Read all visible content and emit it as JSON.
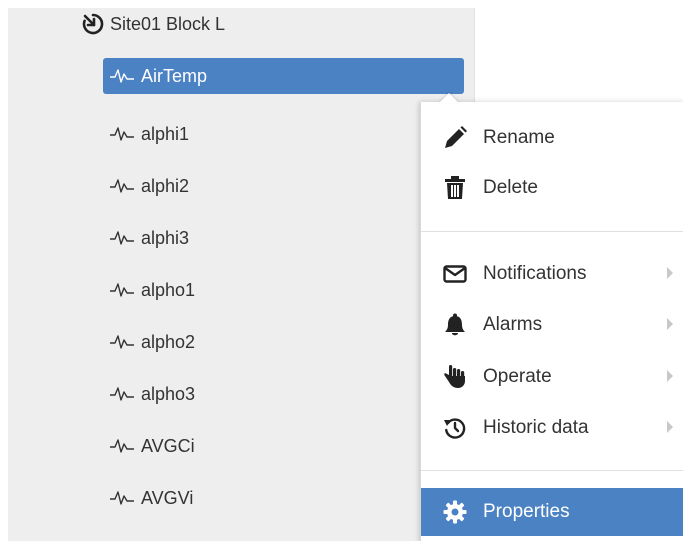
{
  "tree": {
    "root_label": "Site01 Block L",
    "items": [
      {
        "label": "AirTemp",
        "selected": true
      },
      {
        "label": "alphi1"
      },
      {
        "label": "alphi2"
      },
      {
        "label": "alphi3"
      },
      {
        "label": "alpho1"
      },
      {
        "label": "alpho2"
      },
      {
        "label": "alpho3"
      },
      {
        "label": "AVGCi"
      },
      {
        "label": "AVGVi"
      }
    ]
  },
  "context_menu": {
    "rename": "Rename",
    "delete": "Delete",
    "notifications": "Notifications",
    "alarms": "Alarms",
    "operate": "Operate",
    "historic_data": "Historic data",
    "properties": "Properties"
  },
  "colors": {
    "selection": "#4b82c4",
    "panel_bg": "#eeeeee",
    "text": "#333333"
  },
  "icons": {
    "root": "site-link-icon",
    "item": "signal-icon",
    "rename": "pencil-icon",
    "delete": "trash-icon",
    "notifications": "envelope-icon",
    "alarms": "bell-icon",
    "operate": "hand-icon",
    "historic_data": "history-icon",
    "properties": "gear-icon"
  }
}
